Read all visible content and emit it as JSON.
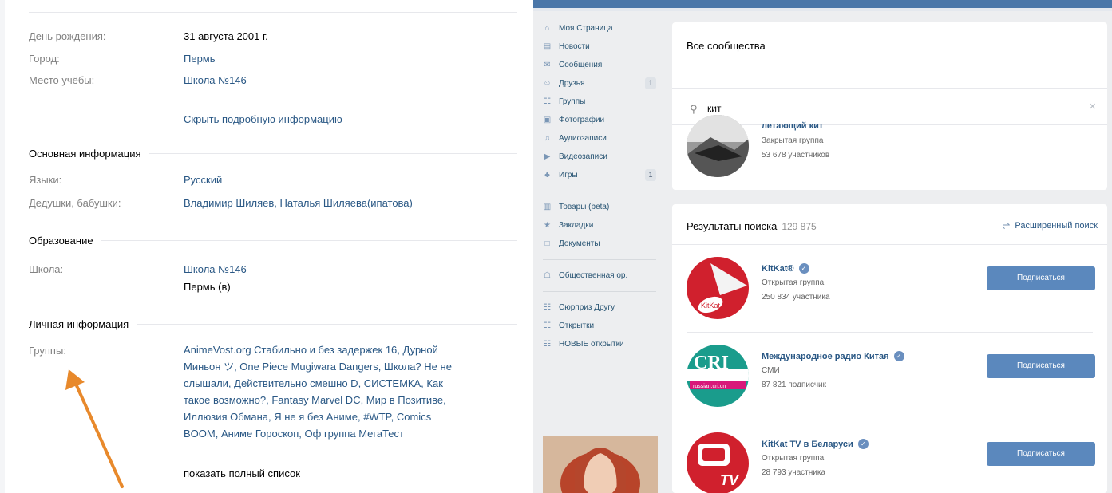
{
  "profile": {
    "info_rows": [
      {
        "label": "День рождения:",
        "value": "31 августа 2001 г."
      },
      {
        "label": "Город:",
        "value": "Пермь"
      },
      {
        "label": "Место учёбы:",
        "value": "Школа №146"
      }
    ],
    "hide_details": "Скрыть подробную информацию",
    "sections": {
      "basic": {
        "title": "Основная информация",
        "rows": [
          {
            "label": "Языки:",
            "value": "Русский"
          },
          {
            "label": "Дедушки, бабушки:",
            "value": "Владимир Шиляев, Наталья Шиляева(ипатова)"
          }
        ]
      },
      "education": {
        "title": "Образование",
        "label": "Школа:",
        "school": "Школа №146",
        "city": "Пермь (в)"
      },
      "personal": {
        "title": "Личная информация",
        "groups_label": "Группы:",
        "groups_lines": [
          "AnimeVost.org Стабильно и без задержек 16, Дурной",
          "Миньон ツ, One Piece Mugiwara Dangers, Школа? Не не",
          "слышали, Действительно смешно D, СИСТЕМКА, Как",
          "такое возможно?, Fantasy Marvel DC, Мир в Позитиве,",
          "Иллюзия Обмана, Я не я без Аниме, #WTP, Comics",
          "BOOM, Аниме Гороскоп, Оф группа МегаТест"
        ],
        "show_full": "показать полный список"
      }
    },
    "arrow_color": "#e8892b"
  },
  "vk": {
    "nav": [
      {
        "label": "Моя Страница",
        "icon": "home-icon"
      },
      {
        "label": "Новости",
        "icon": "news-icon"
      },
      {
        "label": "Сообщения",
        "icon": "messages-icon"
      },
      {
        "label": "Друзья",
        "icon": "friends-icon",
        "count": "1"
      },
      {
        "label": "Группы",
        "icon": "groups-icon"
      },
      {
        "label": "Фотографии",
        "icon": "photo-icon"
      },
      {
        "label": "Аудиозаписи",
        "icon": "music-icon"
      },
      {
        "label": "Видеозаписи",
        "icon": "video-icon"
      },
      {
        "label": "Игры",
        "icon": "games-icon",
        "count": "1"
      }
    ],
    "nav2": [
      {
        "label": "Товары (beta)",
        "icon": "goods-icon"
      },
      {
        "label": "Закладки",
        "icon": "star-icon"
      },
      {
        "label": "Документы",
        "icon": "docs-icon"
      }
    ],
    "nav3": [
      {
        "label": "Общественная ор.",
        "icon": "org-icon"
      }
    ],
    "nav4": [
      {
        "label": "Сюрприз Другу",
        "icon": "app-icon"
      },
      {
        "label": "Открытки",
        "icon": "app-icon"
      },
      {
        "label": "НОВЫЕ открытки",
        "icon": "app-icon"
      }
    ],
    "communities": {
      "title": "Все сообщества",
      "search_value": "кит",
      "top_result": {
        "name": "летающий кит",
        "type": "Закрытая группа",
        "members": "53 678 участников"
      }
    },
    "results": {
      "title": "Результаты поиска",
      "count": "129 875",
      "advanced": "Расширенный поиск",
      "items": [
        {
          "name": "KitKat®",
          "type": "Открытая группа",
          "members": "250 834 участника",
          "button": "Подписаться",
          "verified": true
        },
        {
          "name": "Международное радио Китая",
          "type": "СМИ",
          "members": "87 821 подписчик",
          "button": "Подписаться",
          "verified": true
        },
        {
          "name": "KitKat TV в Беларуси",
          "type": "Открытая группа",
          "members": "28 793 участника",
          "button": "Подписаться",
          "verified": true
        }
      ],
      "logo_text": {
        "kitkat": "KitKat",
        "cri": "CRI",
        "cri_sub": "russian.cri.cn",
        "tv": "TV"
      }
    },
    "colors": {
      "header": "#4a76a8",
      "button": "#5b88bd",
      "link": "#2a5885"
    }
  }
}
